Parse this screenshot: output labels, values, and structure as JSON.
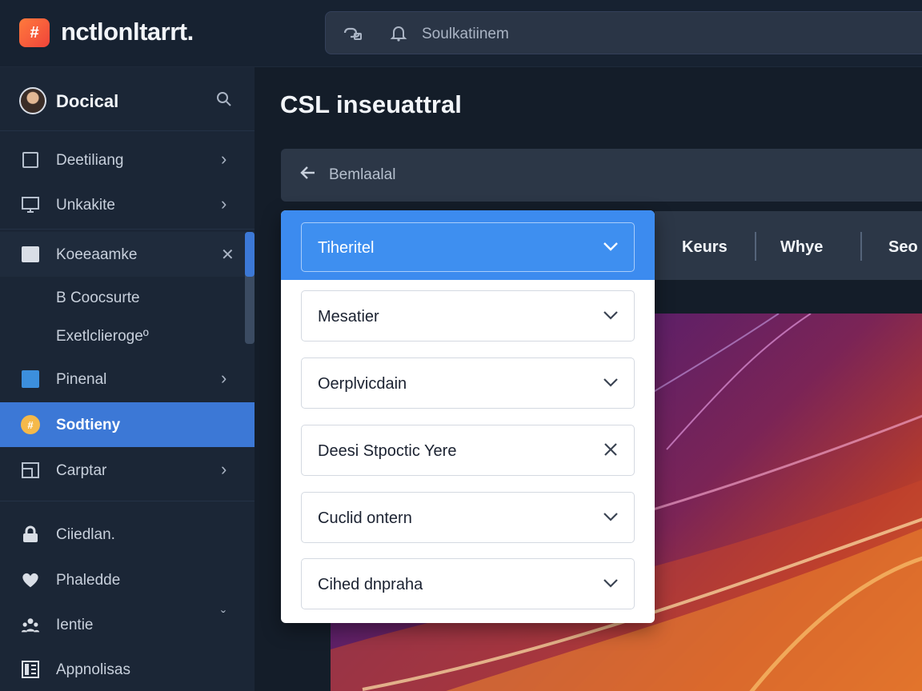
{
  "app": {
    "logo_glyph": "#",
    "title": "nctlonltarrt."
  },
  "search": {
    "text": "Soulkatiinem",
    "icon_left": "link-icon",
    "icon_right": "bell-icon"
  },
  "sidebar": {
    "title": "Docical",
    "items": [
      {
        "label": "Deetiliang",
        "icon": "document-icon"
      },
      {
        "label": "Unkakite",
        "icon": "monitor-icon"
      },
      {
        "label": "Koeeaamke",
        "icon": "book-icon"
      },
      {
        "label": "Pinenal",
        "icon": "folder-icon"
      },
      {
        "label": "Sodtieny",
        "icon": "coin-icon",
        "active": true
      },
      {
        "label": "Carptar",
        "icon": "layout-icon"
      },
      {
        "label": "Ciiedlan.",
        "icon": "lock-icon"
      },
      {
        "label": "Phaledde",
        "icon": "heart-icon"
      },
      {
        "label": "Ientie",
        "icon": "users-icon"
      },
      {
        "label": "Appnolisas",
        "icon": "grid-icon"
      }
    ],
    "sub_items": [
      "B Coocsurte",
      "Exetlclierogeº"
    ]
  },
  "main": {
    "title": "CSL inseuattral",
    "breadcrumb": "Bemlaalal",
    "tabs": [
      "Keurs",
      "Whye",
      "Seo"
    ]
  },
  "dropdown": {
    "selected": "Tiheritel",
    "options": [
      {
        "label": "Mesatier",
        "action": "chevron"
      },
      {
        "label": "Oerplvicdain",
        "action": "chevron"
      },
      {
        "label": "Deesi Stpoctic Yere",
        "action": "close"
      },
      {
        "label": "Cuclid ontern",
        "action": "chevron"
      },
      {
        "label": "Cihed dnpraha",
        "action": "chevron"
      }
    ]
  },
  "colors": {
    "accent": "#3c8bef",
    "sidebar_active": "#3c78d6",
    "background": "#141d29"
  }
}
